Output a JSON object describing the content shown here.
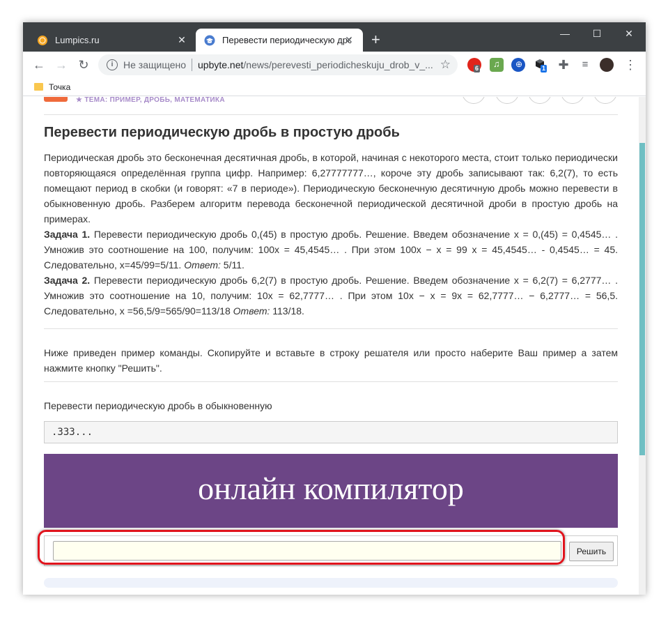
{
  "browser": {
    "tabs": [
      {
        "title": "Lumpics.ru",
        "active": false
      },
      {
        "title": "Перевести периодическую дроб",
        "active": true
      }
    ],
    "new_tab": "+",
    "controls": {
      "minimize": "—",
      "maximize": "☐",
      "close": "✕"
    },
    "security_text": "Не защищено",
    "url_host": "upbyte.net",
    "url_path": "/news/perevesti_periodicheskuju_drob_v_...",
    "extensions": [
      {
        "icon": "opera-icon",
        "badge": "6",
        "color": "#e0251b"
      },
      {
        "icon": "music-icon",
        "badge": "",
        "color": "#6aa84f"
      },
      {
        "icon": "vpn-icon",
        "badge": "",
        "color": "#1a56c4"
      },
      {
        "icon": "box-icon",
        "badge": "1",
        "color": "#202124"
      }
    ],
    "bookmark": "Точка"
  },
  "article": {
    "tags": "★ ТЕМА: ПРИМЕР, ДРОБЬ, МАТЕМАТИКА",
    "title": "Перевести периодическую дробь в простую дробь",
    "intro": "Периодическая дробь это бесконечная десятичная дробь, в которой, начиная с некоторого места, стоит только периодически повторяющаяся определённая группа цифр. Например: 6,27777777…, короче эту дробь записывают так: 6,2(7), то есть помещают период в скобки (и говорят: «7 в периоде»). Периодическую бесконечную десятичную дробь можно перевести в обыкновенную дробь. Разберем алгоритм перевода бесконечной периодической десятичной дроби в простую дробь на примерах.",
    "task1_label": "Задача 1.",
    "task1_text": " Перевести периодическую дробь 0,(45) в простую дробь. Решение. Введем обозначение x = 0,(45) = 0,4545… . Умножив это соотношение на 100, получим: 100x = 45,4545… . При этом 100x − x = 99 x = 45,4545… - 0,4545… = 45. Следовательно, x=45/99=5/11. ",
    "task1_answer_label": "Ответ:",
    "task1_answer": " 5/11.",
    "task2_label": "Задача 2.",
    "task2_text": " Перевести периодическую дробь 6,2(7) в простую дробь. Решение. Введем обозначение x = 6,2(7) = 6,2777… . Умножив это соотношение на 10, получим: 10x = 62,7777… . При этом 10x − x = 9x = 62,7777… − 6,2777… = 56,5. Следовательно, x =56,5/9=565/90=113/18 ",
    "task2_answer_label": "Ответ:",
    "task2_answer": " 113/18."
  },
  "solver": {
    "instructions": "Ниже приведен пример команды. Скопируйте и вставьте в строку решателя или просто наберите Ваш пример а затем нажмите кнопку \"Решить\".",
    "example_label": "Перевести периодическую дробь в обыкновенную",
    "example_value": ".333...",
    "banner": "онлайн компилятор",
    "input_value": "",
    "solve_button": "Решить"
  }
}
